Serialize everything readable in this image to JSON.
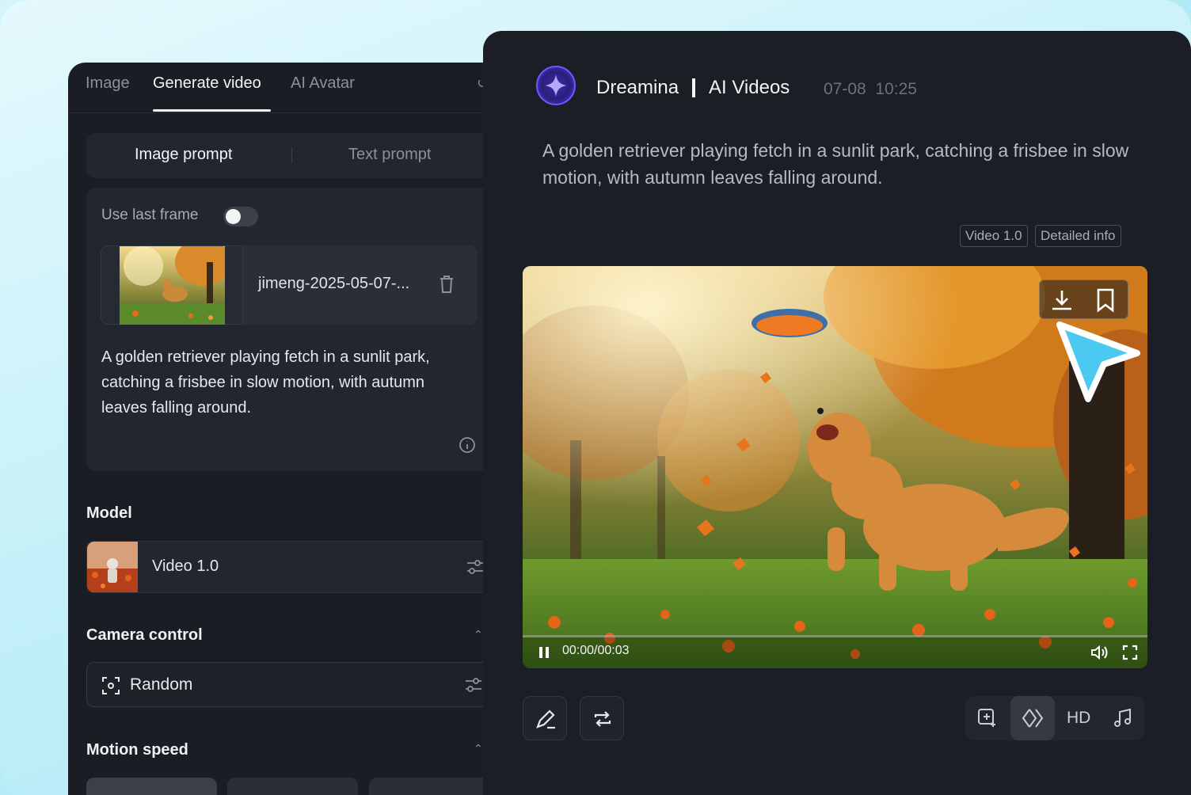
{
  "left": {
    "tabs": [
      "Image",
      "Generate video",
      "AI Avatar"
    ],
    "prompt_modes": [
      "Image prompt",
      "Text prompt"
    ],
    "use_last_frame_label": "Use last frame",
    "use_last_frame_on": false,
    "file_name": "jimeng-2025-05-07-...",
    "prompt": "A golden retriever playing fetch in a sunlit park, catching a frisbee in slow motion, with autumn leaves falling around.",
    "model_section": "Model",
    "model_name": "Video 1.0",
    "camera_section": "Camera control",
    "camera_value": "Random",
    "speed_section": "Motion speed"
  },
  "right": {
    "brand": "Dreamina",
    "separator": "|",
    "subtitle": "AI Videos",
    "time": "07-08  10:25",
    "description": "A golden retriever playing fetch in a sunlit park, catching a frisbee in slow motion, with autumn leaves falling around.",
    "tags": [
      "Video 1.0",
      "Detailed info"
    ],
    "video_time": "00:00/00:03",
    "video_progress": 0,
    "hd_label": "HD"
  },
  "colors": {
    "panel_bg": "#1b1e25",
    "accent_cursor": "#4cc9f0",
    "brand_purple": "#6f56ff"
  }
}
